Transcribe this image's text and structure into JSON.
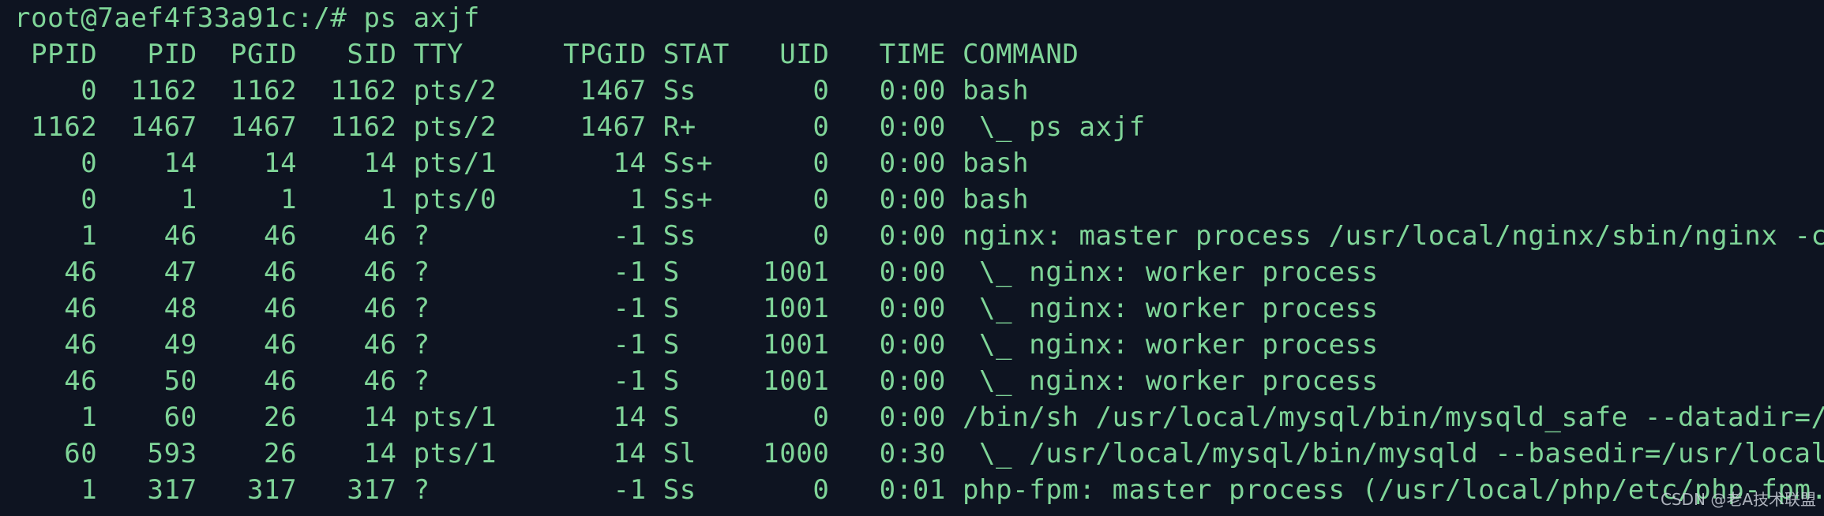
{
  "terminal": {
    "prompt": "root@7aef4f33a91c:/# ps axjf",
    "header": " PPID   PID  PGID   SID TTY      TPGID STAT   UID   TIME COMMAND",
    "rows": [
      "    0  1162  1162  1162 pts/2     1467 Ss       0   0:00 bash",
      " 1162  1467  1467  1162 pts/2     1467 R+       0   0:00  \\_ ps axjf",
      "    0    14    14    14 pts/1       14 Ss+      0   0:00 bash",
      "    0     1     1     1 pts/0        1 Ss+      0   0:00 bash",
      "    1    46    46    46 ?           -1 Ss       0   0:00 nginx: master process /usr/local/nginx/sbin/nginx -c",
      "   46    47    46    46 ?           -1 S     1001   0:00  \\_ nginx: worker process",
      "   46    48    46    46 ?           -1 S     1001   0:00  \\_ nginx: worker process",
      "   46    49    46    46 ?           -1 S     1001   0:00  \\_ nginx: worker process",
      "   46    50    46    46 ?           -1 S     1001   0:00  \\_ nginx: worker process",
      "    1    60    26    14 pts/1       14 S        0   0:00 /bin/sh /usr/local/mysql/bin/mysqld_safe --datadir=/",
      "   60   593    26    14 pts/1       14 Sl    1000   0:30  \\_ /usr/local/mysql/bin/mysqld --basedir=/usr/local",
      "    1   317   317   317 ?           -1 Ss       0   0:01 php-fpm: master process (/usr/local/php/etc/php-fpm."
    ],
    "text_color": "#7fd598",
    "background_color": "#0e1421"
  },
  "watermark": {
    "text": "CSDN @老A技术联盟"
  }
}
